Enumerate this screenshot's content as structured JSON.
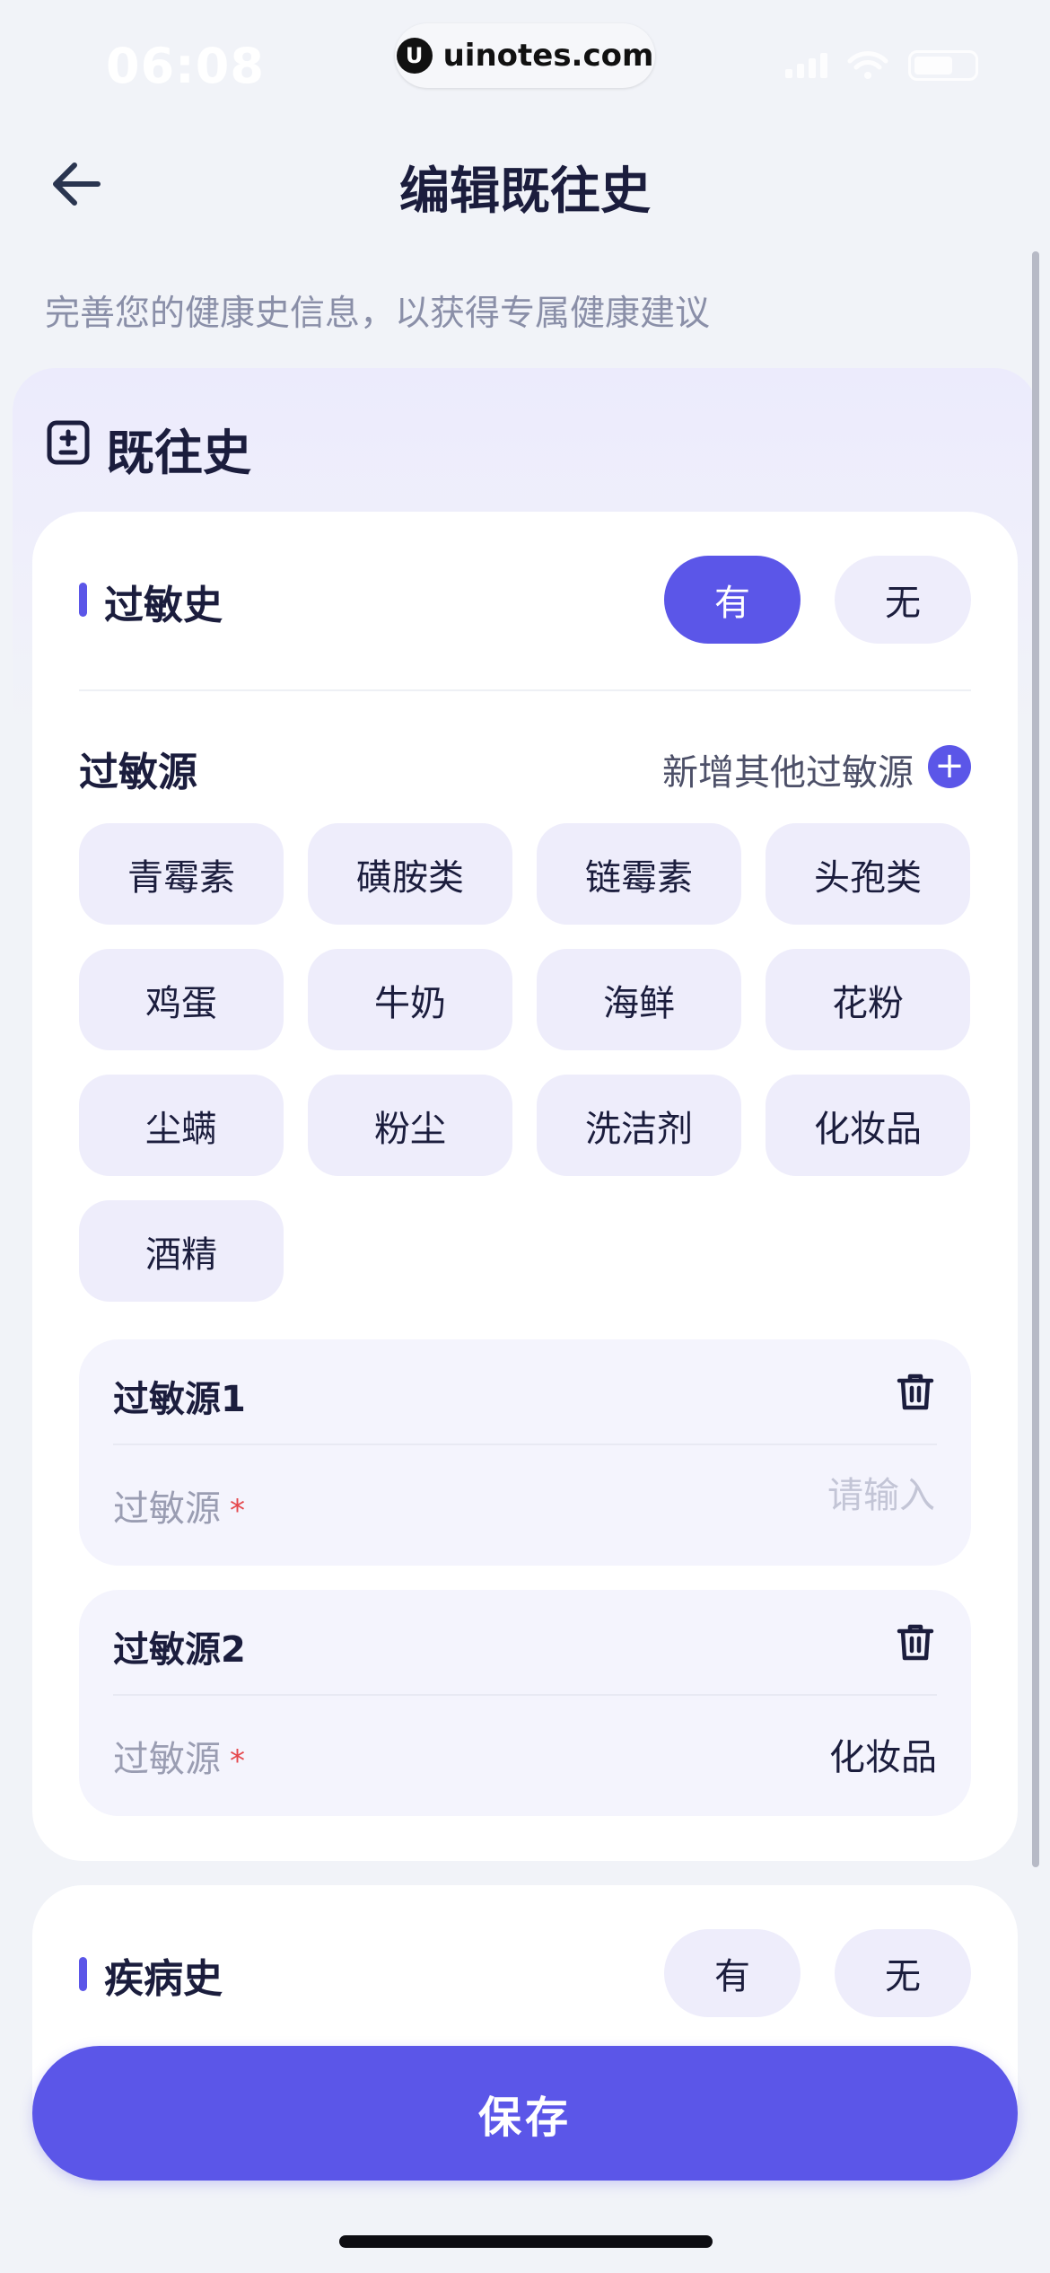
{
  "status_bar": {
    "time": "06:08",
    "url": "uinotes.com"
  },
  "header": {
    "title": "编辑既往史"
  },
  "subtitle": "完善您的健康史信息，以获得专属健康建议",
  "section": {
    "title": "既往史"
  },
  "allergy": {
    "title": "过敏史",
    "option_yes": "有",
    "option_no": "无",
    "selected": "有",
    "sources_title": "过敏源",
    "add_label": "新增其他过敏源",
    "chips": [
      "青霉素",
      "磺胺类",
      "链霉素",
      "头孢类",
      "鸡蛋",
      "牛奶",
      "海鲜",
      "花粉",
      "尘螨",
      "粉尘",
      "洗洁剂",
      "化妆品",
      "酒精"
    ],
    "entries": [
      {
        "title": "过敏源1",
        "field_label": "过敏源",
        "required_mark": "*",
        "placeholder": "请输入",
        "value": ""
      },
      {
        "title": "过敏源2",
        "field_label": "过敏源",
        "required_mark": "*",
        "placeholder": "请输入",
        "value": "化妆品"
      }
    ]
  },
  "disease": {
    "title": "疾病史",
    "option_yes": "有",
    "option_no": "无"
  },
  "save_label": "保存",
  "colors": {
    "primary": "#5b56e8",
    "chip_bg": "#eeedfb",
    "required": "#e5484d"
  }
}
